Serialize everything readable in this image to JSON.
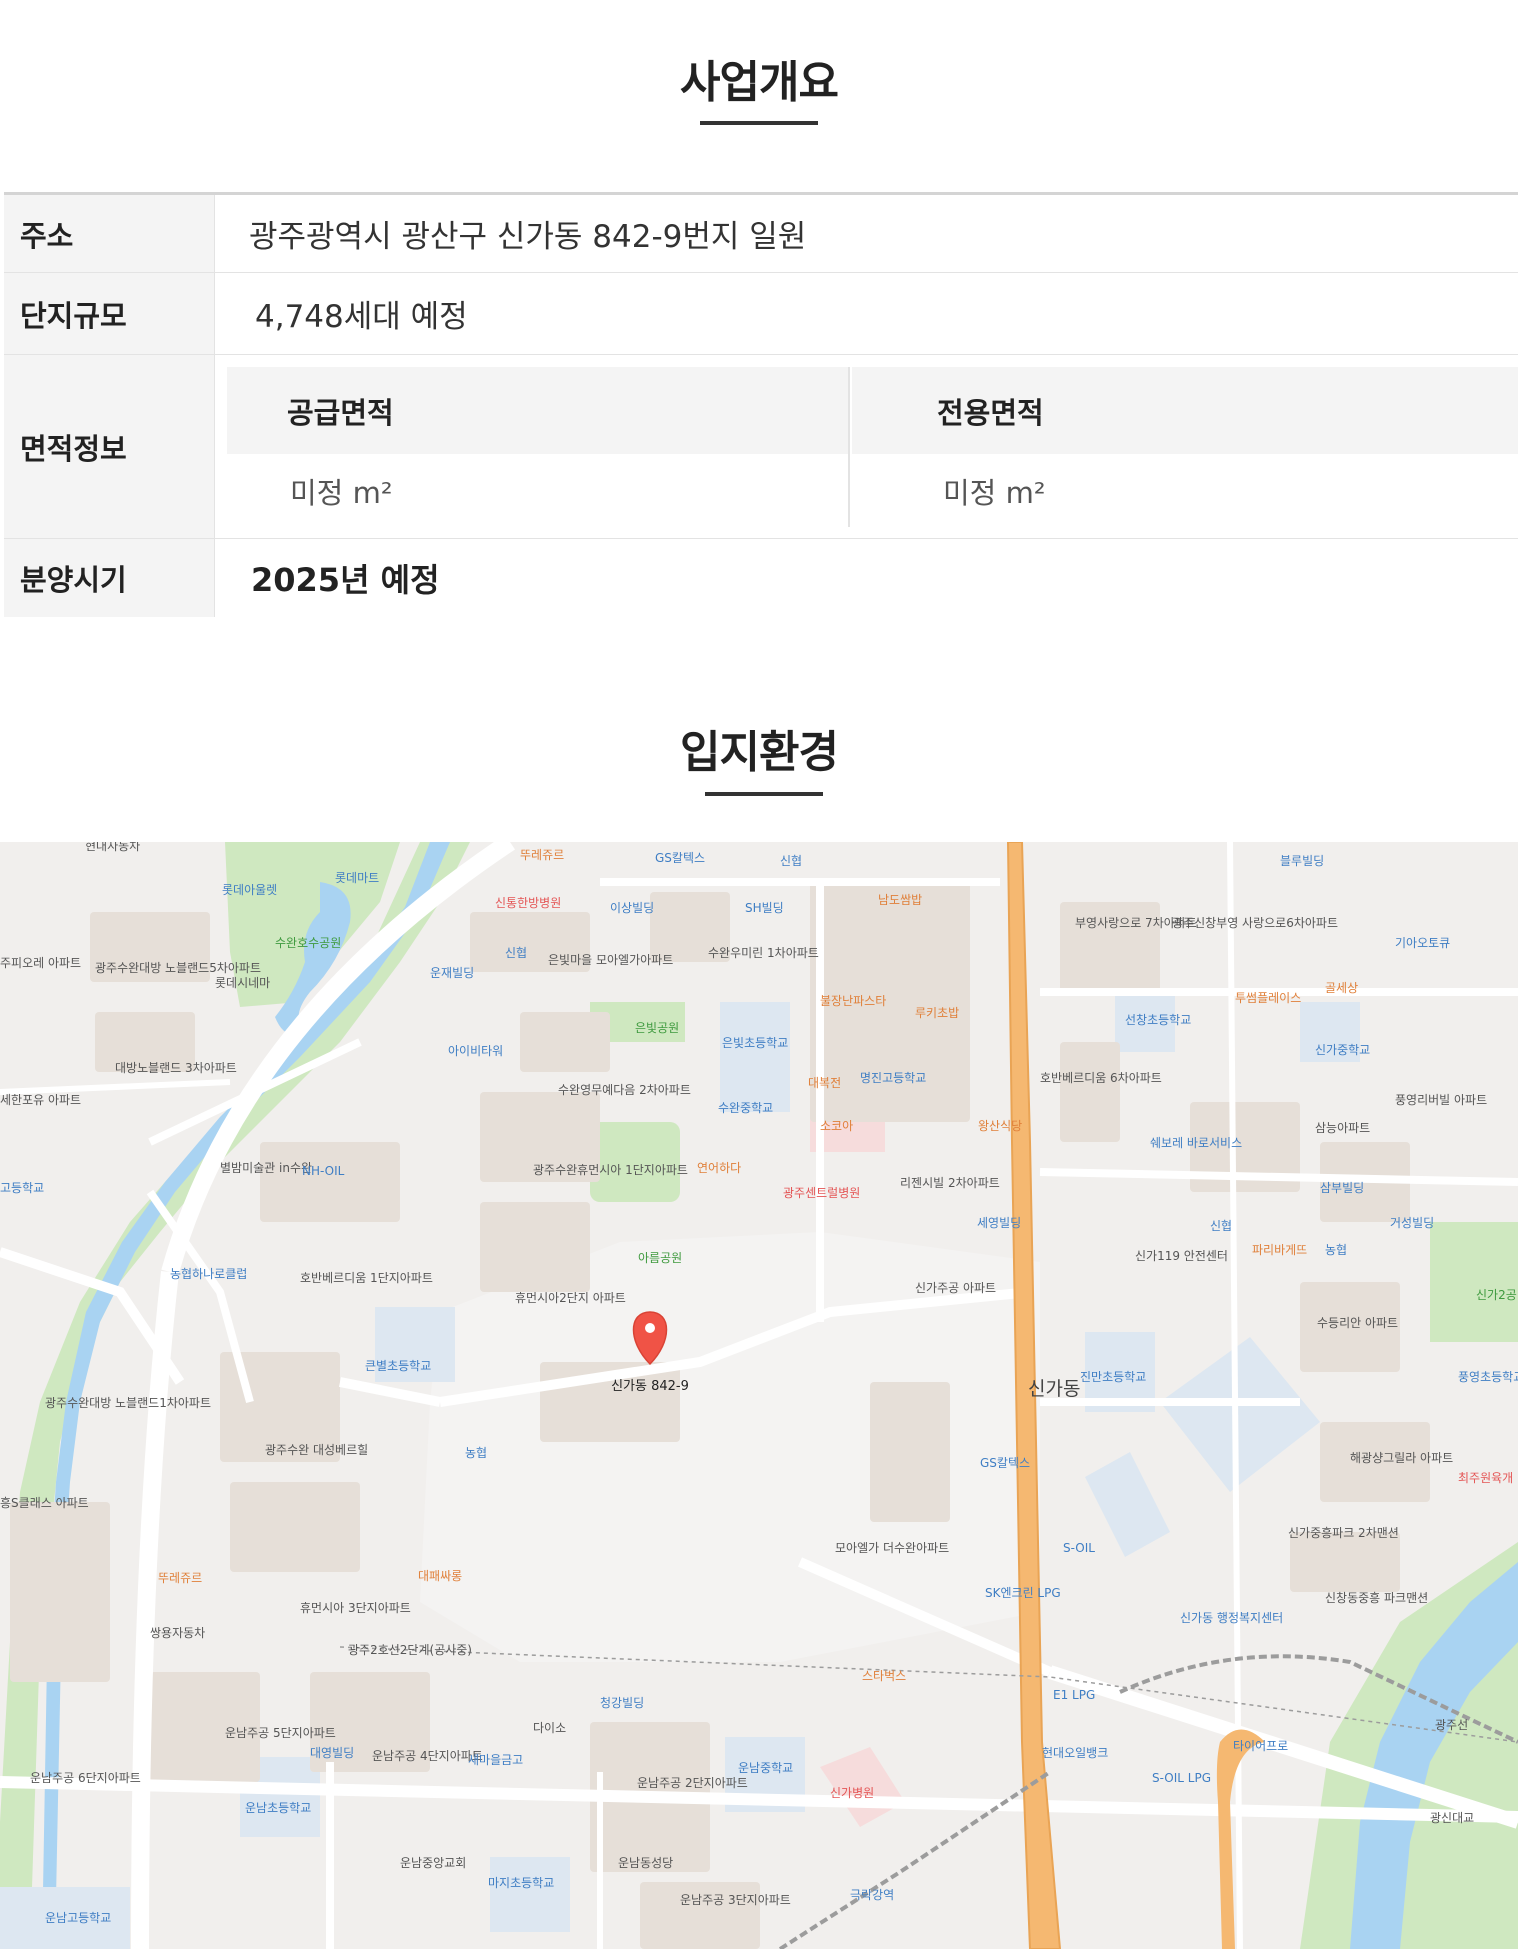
{
  "overview": {
    "title": "사업개요",
    "rows": {
      "address": {
        "label": "주소",
        "value": "광주광역시 광산구 신가동 842-9번지 일원"
      },
      "scale": {
        "label": "단지규모",
        "value": "4,748세대 예정"
      },
      "area": {
        "label": "면적정보",
        "supply_label": "공급면적",
        "supply_value": "미정 m²",
        "exclusive_label": "전용면적",
        "exclusive_value": "미정 m²"
      },
      "sale": {
        "label": "분양시기",
        "value": "2025년 예정"
      }
    }
  },
  "location": {
    "title": "입지환경",
    "map": {
      "marker_label": "신가동 842-9",
      "district_label": "신가동",
      "place_labels": [
        "현대자동차",
        "뚜레쥬르",
        "GS칼텍스",
        "신협",
        "블루빌딩",
        "롯데아울렛",
        "롯데마트",
        "신통한방병원",
        "이상빌딩",
        "SH빌딩",
        "남도쌈밥",
        "부영사랑으로 7차아파트",
        "광주신창부영 사랑으로6차아파트",
        "기아오토큐",
        "수완호수공원",
        "주피오레 아파트",
        "광주수완대방 노블랜드5차아파트",
        "롯데시네마",
        "운재빌딩",
        "신협",
        "은빛마을 모아엘가아파트",
        "수완우미린 1차아파트",
        "불장난파스타",
        "투썸플레이스",
        "골세상",
        "루키초밥",
        "선창초등학교",
        "은빛공원",
        "아이비타워",
        "은빛초등학교",
        "명진고등학교",
        "신가중학교",
        "대방노블랜드 3차아파트",
        "대복전",
        "호반베르디움 6차아파트",
        "수완영무예다음 2차아파트",
        "풍영리버빌 아파트",
        "세한포유 아파트",
        "수완중학교",
        "소코아",
        "왕산식당",
        "삼능아파트",
        "쉐보레 바로서비스",
        "별밤미술관 in수완",
        "NH-OIL",
        "고등학교",
        "광주수완휴먼시아 1단지아파트",
        "연어하다",
        "광주센트럴병원",
        "리젠시빌 2차아파트",
        "삼부빌딩",
        "세영빌딩",
        "신협",
        "거성빌딩",
        "농협하나로클럽",
        "아름공원",
        "신가119 안전센터",
        "파리바게뜨",
        "농협",
        "호반베르디움 1단지아파트",
        "휴먼시아2단지 아파트",
        "신가주공 아파트",
        "신가2공",
        "수등리안 아파트",
        "큰별초등학교",
        "진만초등학교",
        "풍영초등학교",
        "광주수완대방 노블랜드1차아파트",
        "광주수완 대성베르힐",
        "농협",
        "GS칼텍스",
        "해광샹그릴라 아파트",
        "최주원육개",
        "흥S클래스 아파트",
        "S-OIL",
        "신가중흥파크 2차맨션",
        "모아엘가 더수완아파트",
        "뚜레쥬르",
        "대패싸롱",
        "SK엔크린 LPG",
        "신가동 행정복지센터",
        "신창동중흥 파크맨션",
        "휴먼시아 3단지아파트",
        "쌍용자동차",
        "광주2호선2단계(공사중)",
        "스타벅스",
        "E1 LPG",
        "광주선",
        "청강빌딩",
        "운남주공 5단지아파트",
        "다이소",
        "운남주공 4단지아파트",
        "대영빌딩",
        "새마을금고",
        "운남주공 2단지아파트",
        "운남중학교",
        "현대오일뱅크",
        "타이어프로",
        "S-OIL LPG",
        "광신대교",
        "운남주공 6단지아파트",
        "운남초등학교",
        "신가병원",
        "운남중앙교회",
        "운남동성당",
        "마지초등학교",
        "운남주공 3단지아파트",
        "극락강역",
        "운남고등학교"
      ]
    }
  }
}
